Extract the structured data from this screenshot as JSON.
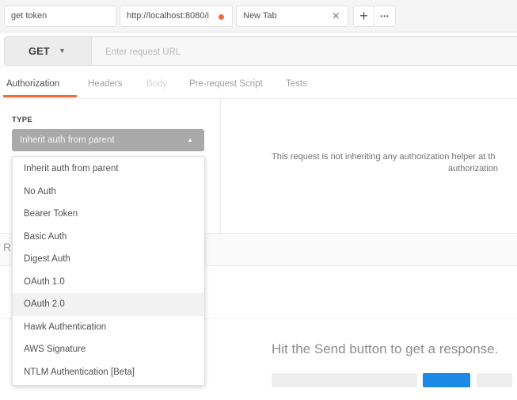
{
  "tabs": [
    {
      "label": "get token"
    },
    {
      "label": "http://localhost:8080/i",
      "unsaved": true
    },
    {
      "label": "New Tab",
      "close": "×"
    }
  ],
  "tabbar": {
    "add": "+",
    "more": "•••"
  },
  "request": {
    "method": "GET",
    "method_caret": "▼",
    "url_placeholder": "Enter request URL"
  },
  "request_tabs": [
    {
      "label": "Authorization",
      "state": "active"
    },
    {
      "label": "Headers",
      "state": "normal"
    },
    {
      "label": "Body",
      "state": "disabled"
    },
    {
      "label": "Pre-request Script",
      "state": "normal"
    },
    {
      "label": "Tests",
      "state": "normal"
    }
  ],
  "auth": {
    "type_label": "TYPE",
    "selected": "Inherit auth from parent",
    "caret": "▲",
    "info_line1": "This request is not inheriting any authorization helper at th",
    "info_line2": "authorization",
    "options": [
      "Inherit auth from parent",
      "No Auth",
      "Bearer Token",
      "Basic Auth",
      "Digest Auth",
      "OAuth 1.0",
      "OAuth 2.0",
      "Hawk Authentication",
      "AWS Signature",
      "NTLM Authentication [Beta]"
    ],
    "hovered_option": "OAuth 2.0"
  },
  "response": {
    "partial_label": "R",
    "hint": "Hit the Send button to get a response."
  },
  "colors": {
    "accent": "#f26b3a",
    "send_blue": "#1a8ae6"
  }
}
